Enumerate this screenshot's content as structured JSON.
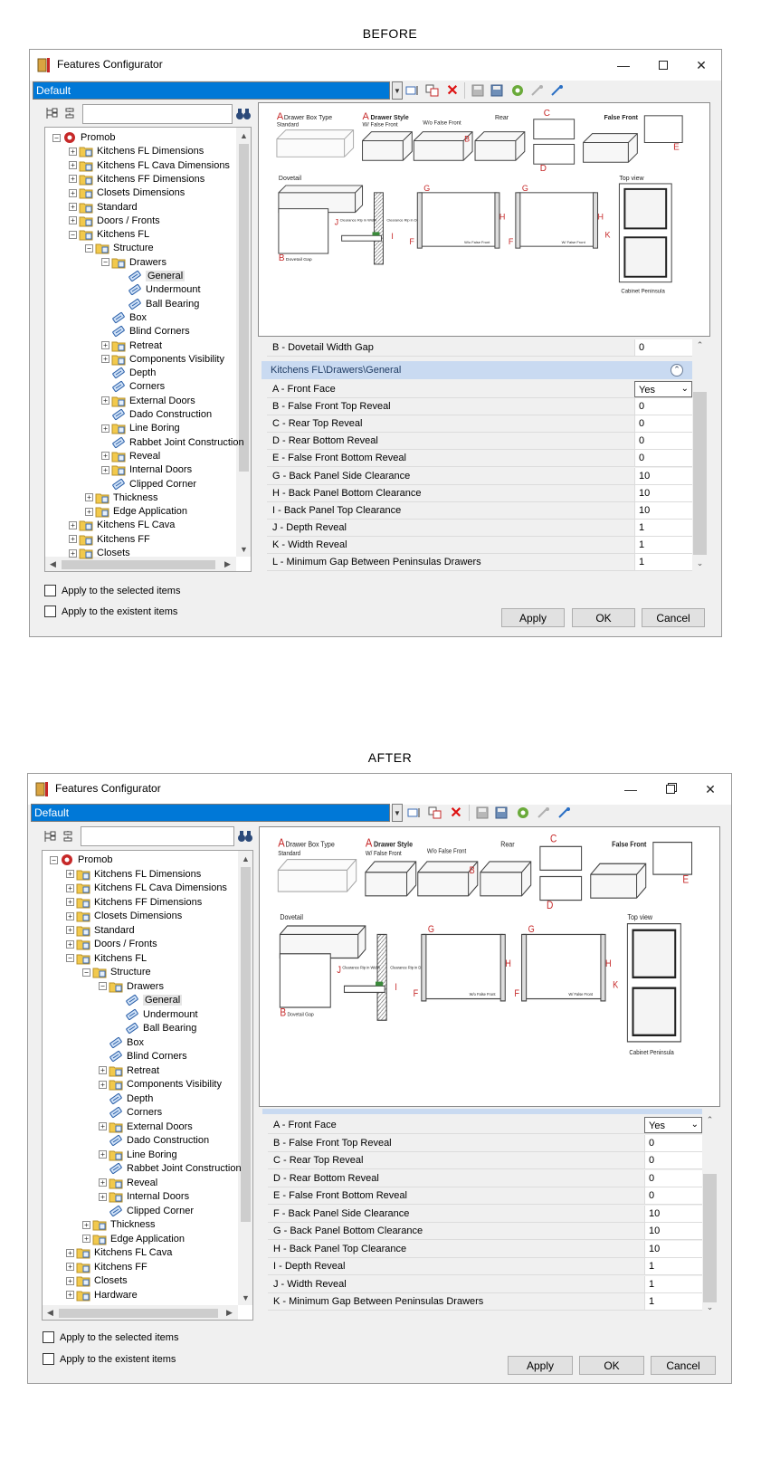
{
  "before_caption": "BEFORE",
  "after_caption": "AFTER",
  "window": {
    "title": "Features Configurator",
    "profile": "Default",
    "minimize_icon": "minimize-icon",
    "maximize_icon": "maximize-icon",
    "restore_icon": "restore-icon",
    "close_icon": "close-icon"
  },
  "toolbar_icons": [
    "rename-icon",
    "copy-icon",
    "delete-icon",
    "save-icon",
    "save-as-icon",
    "settings-icon",
    "import-icon",
    "export-icon"
  ],
  "tree_before": [
    {
      "label": "Promob",
      "level": 0,
      "expander": "-",
      "icon": "promob-logo"
    },
    {
      "label": "Kitchens FL Dimensions",
      "level": 1,
      "expander": "+",
      "icon": "folder"
    },
    {
      "label": "Kitchens FL Cava Dimensions",
      "level": 1,
      "expander": "+",
      "icon": "folder"
    },
    {
      "label": "Kitchens FF Dimensions",
      "level": 1,
      "expander": "+",
      "icon": "folder"
    },
    {
      "label": "Closets Dimensions",
      "level": 1,
      "expander": "+",
      "icon": "folder"
    },
    {
      "label": "Standard",
      "level": 1,
      "expander": "+",
      "icon": "folder"
    },
    {
      "label": "Doors / Fronts",
      "level": 1,
      "expander": "+",
      "icon": "folder"
    },
    {
      "label": "Kitchens FL",
      "level": 1,
      "expander": "-",
      "icon": "folder"
    },
    {
      "label": "Structure",
      "level": 2,
      "expander": "-",
      "icon": "folder"
    },
    {
      "label": "Drawers",
      "level": 3,
      "expander": "-",
      "icon": "folder"
    },
    {
      "label": "General",
      "level": 4,
      "expander": "",
      "icon": "leaf",
      "selected": true
    },
    {
      "label": "Undermount",
      "level": 4,
      "expander": "",
      "icon": "leaf"
    },
    {
      "label": "Ball Bearing",
      "level": 4,
      "expander": "",
      "icon": "leaf"
    },
    {
      "label": "Box",
      "level": 3,
      "expander": "",
      "icon": "leaf"
    },
    {
      "label": "Blind Corners",
      "level": 3,
      "expander": "",
      "icon": "leaf"
    },
    {
      "label": "Retreat",
      "level": 3,
      "expander": "+",
      "icon": "folder"
    },
    {
      "label": "Components Visibility",
      "level": 3,
      "expander": "+",
      "icon": "folder"
    },
    {
      "label": "Depth",
      "level": 3,
      "expander": "",
      "icon": "leaf"
    },
    {
      "label": "Corners",
      "level": 3,
      "expander": "",
      "icon": "leaf"
    },
    {
      "label": "External Doors",
      "level": 3,
      "expander": "+",
      "icon": "folder"
    },
    {
      "label": "Dado Construction",
      "level": 3,
      "expander": "",
      "icon": "leaf"
    },
    {
      "label": "Line Boring",
      "level": 3,
      "expander": "+",
      "icon": "folder"
    },
    {
      "label": "Rabbet Joint Construction",
      "level": 3,
      "expander": "",
      "icon": "leaf"
    },
    {
      "label": "Reveal",
      "level": 3,
      "expander": "+",
      "icon": "folder"
    },
    {
      "label": "Internal Doors",
      "level": 3,
      "expander": "+",
      "icon": "folder"
    },
    {
      "label": "Clipped Corner",
      "level": 3,
      "expander": "",
      "icon": "leaf"
    },
    {
      "label": "Thickness",
      "level": 2,
      "expander": "+",
      "icon": "folder"
    },
    {
      "label": "Edge Application",
      "level": 2,
      "expander": "+",
      "icon": "folder"
    },
    {
      "label": "Kitchens FL Cava",
      "level": 1,
      "expander": "+",
      "icon": "folder"
    },
    {
      "label": "Kitchens FF",
      "level": 1,
      "expander": "+",
      "icon": "folder"
    },
    {
      "label": "Closets",
      "level": 1,
      "expander": "+",
      "icon": "folder"
    }
  ],
  "tree_after_extra": [
    {
      "label": "Hardware",
      "level": 1,
      "expander": "+",
      "icon": "folder"
    }
  ],
  "image": {
    "a_letter": "A",
    "a_title": "Drawer Box Type",
    "a_sub": "Standard",
    "a2_title": "Drawer Style",
    "a2_sub": "W/ False Front",
    "wo_false_front": "W/o False Front",
    "rear": "Rear",
    "false_front": "False Front",
    "dovetail": "Dovetail",
    "dovetail_gap": "Dovetail Gap",
    "clearance_width": "Clearance Rip in Width",
    "clearance_depth": "Clearance Rip in Depth",
    "wo_false_front_small": "W/o False Front",
    "w_false_front_small": "W/ False Front",
    "top_view": "Top view",
    "cabinet_peninsula": "Cabinet Peninsula",
    "letters": {
      "b": "B",
      "c": "C",
      "d": "D",
      "e": "E",
      "f": "F",
      "g": "G",
      "h": "H",
      "i": "I",
      "j": "J",
      "k": "K"
    }
  },
  "props_before": {
    "partial_row": {
      "name": "B - Dovetail Width Gap",
      "value": "0"
    },
    "group_header": "Kitchens FL\\Drawers\\General",
    "rows": [
      {
        "name": "A - Front Face",
        "value": "Yes",
        "dropdown": true
      },
      {
        "name": "B - False Front Top Reveal",
        "value": "0"
      },
      {
        "name": "C - Rear Top Reveal",
        "value": "0"
      },
      {
        "name": "D - Rear Bottom Reveal",
        "value": "0"
      },
      {
        "name": "E - False Front Bottom Reveal",
        "value": "0"
      },
      {
        "name": "G - Back Panel Side Clearance",
        "value": "10"
      },
      {
        "name": "H - Back Panel Bottom Clearance",
        "value": "10"
      },
      {
        "name": "I - Back Panel Top Clearance",
        "value": "10"
      },
      {
        "name": "J - Depth Reveal",
        "value": "1"
      },
      {
        "name": "K - Width Reveal",
        "value": "1"
      },
      {
        "name": "L - Minimum Gap Between Peninsulas Drawers",
        "value": "1"
      }
    ]
  },
  "props_after": {
    "rows": [
      {
        "name": "A - Front Face",
        "value": "Yes",
        "dropdown": true
      },
      {
        "name": "B - False Front Top Reveal",
        "value": "0"
      },
      {
        "name": "C - Rear Top Reveal",
        "value": "0"
      },
      {
        "name": "D - Rear Bottom Reveal",
        "value": "0"
      },
      {
        "name": "E - False Front Bottom Reveal",
        "value": "0"
      },
      {
        "name": "F - Back Panel Side Clearance",
        "value": "10"
      },
      {
        "name": "G - Back Panel Bottom Clearance",
        "value": "10"
      },
      {
        "name": "H - Back Panel Top Clearance",
        "value": "10"
      },
      {
        "name": "I - Depth Reveal",
        "value": "1"
      },
      {
        "name": "J - Width Reveal",
        "value": "1"
      },
      {
        "name": "K - Minimum Gap Between Peninsulas Drawers",
        "value": "1"
      }
    ]
  },
  "checkboxes": {
    "selected_items": "Apply to the selected items",
    "existent_items": "Apply to the existent items"
  },
  "buttons": {
    "apply": "Apply",
    "ok": "OK",
    "cancel": "Cancel"
  },
  "colors": {
    "selection_blue": "#0078d7",
    "group_header": "#c9daf1",
    "diagram_red": "#c62828",
    "folder_yellow": "#f2c94c"
  }
}
